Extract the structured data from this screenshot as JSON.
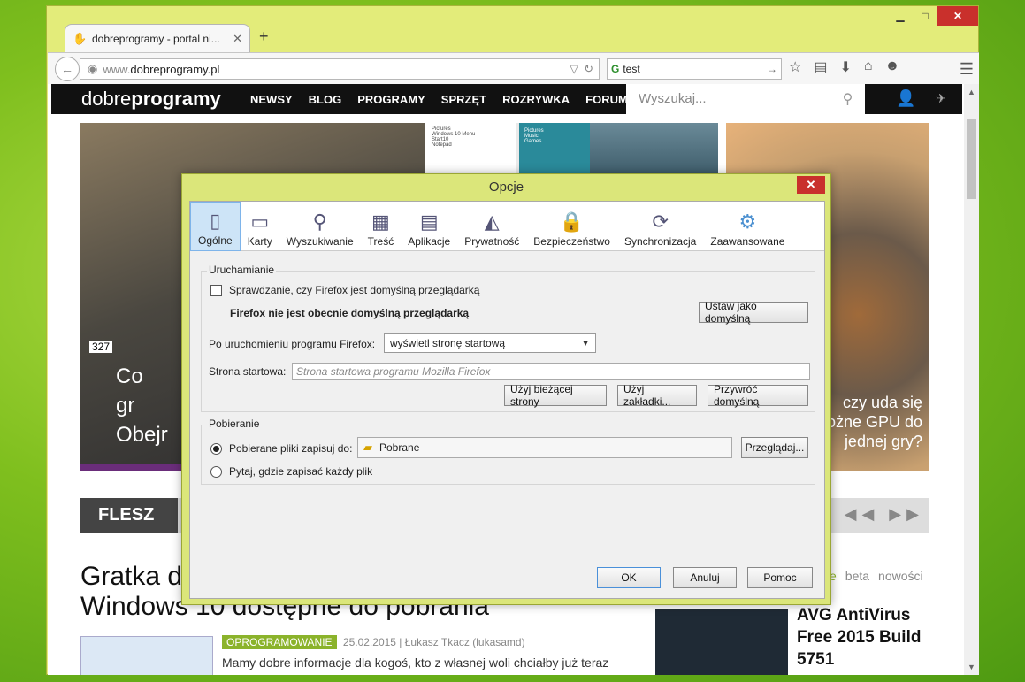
{
  "browser": {
    "tab_title": "dobreprogramy - portal ni...",
    "url_prefix": "www.",
    "url_domain": "dobreprogramy.pl",
    "search_value": "test",
    "window_controls": {
      "minimize": "▁",
      "maximize": "□",
      "close": "✕"
    }
  },
  "site": {
    "logo_light": "dobre",
    "logo_bold": "programy",
    "nav": [
      "NEWSY",
      "BLOG",
      "PROGRAMY",
      "SPRZĘT",
      "ROZRYWKA",
      "FORUM"
    ],
    "search_placeholder": "Wyszukaj...",
    "hero_left_count": "327",
    "hero_left_text": "Co\ngr\nObejr",
    "hero_mid_menu": [
      "Pictures",
      "Windows 10 Menu",
      "Start10",
      "Notepad"
    ],
    "hero_mid_teal": [
      "Pictures",
      "Music",
      "Games"
    ],
    "hero_right_text": "czy uda się\nożne GPU do\njednej gry?",
    "flesz_label": "FLESZ",
    "flesz_arrows": "◀◀ ▶▶",
    "article_title": "Gratka dl\nWindows 10 dostępne do pobrania",
    "article_category": "OPROGRAMOWANIE",
    "article_meta": "25.02.2015 | Łukasz Tkacz (lukasamd)",
    "article_body": "Mamy dobre informacje dla kogoś, kto z własnej woli chciałby już teraz",
    "side_tabs": [
      "ilne",
      "beta",
      "nowości"
    ],
    "side_title": "AVG AntiVirus\nFree 2015 Build\n5751"
  },
  "dialog": {
    "title": "Opcje",
    "tabs": [
      {
        "label": "Ogólne",
        "icon": "switch-icon"
      },
      {
        "label": "Karty",
        "icon": "tabs-icon"
      },
      {
        "label": "Wyszukiwanie",
        "icon": "search-icon"
      },
      {
        "label": "Treść",
        "icon": "content-icon"
      },
      {
        "label": "Aplikacje",
        "icon": "applications-icon"
      },
      {
        "label": "Prywatność",
        "icon": "privacy-mask-icon"
      },
      {
        "label": "Bezpieczeństwo",
        "icon": "lock-icon"
      },
      {
        "label": "Synchronizacja",
        "icon": "sync-icon"
      },
      {
        "label": "Zaawansowane",
        "icon": "gear-icon"
      }
    ],
    "startup": {
      "group_label": "Uruchamianie",
      "default_check_label": "Sprawdzanie, czy Firefox jest domyślną przeglądarką",
      "not_default_text": "Firefox nie jest obecnie domyślną przeglądarką",
      "set_default_button": "Ustaw jako domyślną",
      "on_start_label": "Po uruchomieniu programu Firefox:",
      "on_start_value": "wyświetl stronę startową",
      "homepage_label": "Strona startowa:",
      "homepage_placeholder": "Strona startowa programu Mozilla Firefox",
      "use_current_button": "Użyj bieżącej strony",
      "use_bookmark_button": "Użyj zakładki...",
      "restore_default_button": "Przywróć domyślną"
    },
    "downloads": {
      "group_label": "Pobieranie",
      "save_to_label": "Pobierane pliki zapisuj do:",
      "folder": "Pobrane",
      "browse_button": "Przeglądaj...",
      "ask_label": "Pytaj, gdzie zapisać każdy plik"
    },
    "buttons": {
      "ok": "OK",
      "cancel": "Anuluj",
      "help": "Pomoc"
    }
  }
}
